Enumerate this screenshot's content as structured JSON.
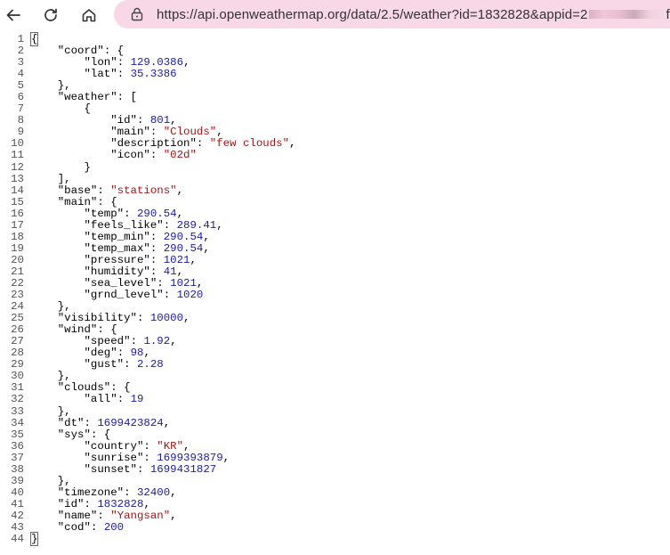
{
  "browser": {
    "url_text": "https://api.openweathermap.org/data/2.5/weather?id=1832828&appid=2",
    "url_tail": "f."
  },
  "json_lines": [
    [
      [
        "p",
        "{"
      ]
    ],
    [
      [
        "p",
        "    "
      ],
      [
        "k",
        "\"coord\""
      ],
      [
        "p",
        ": {"
      ]
    ],
    [
      [
        "p",
        "        "
      ],
      [
        "k",
        "\"lon\""
      ],
      [
        "p",
        ": "
      ],
      [
        "n",
        "129.0386"
      ],
      [
        "p",
        ","
      ]
    ],
    [
      [
        "p",
        "        "
      ],
      [
        "k",
        "\"lat\""
      ],
      [
        "p",
        ": "
      ],
      [
        "n",
        "35.3386"
      ]
    ],
    [
      [
        "p",
        "    },"
      ]
    ],
    [
      [
        "p",
        "    "
      ],
      [
        "k",
        "\"weather\""
      ],
      [
        "p",
        ": ["
      ]
    ],
    [
      [
        "p",
        "        {"
      ]
    ],
    [
      [
        "p",
        "            "
      ],
      [
        "k",
        "\"id\""
      ],
      [
        "p",
        ": "
      ],
      [
        "n",
        "801"
      ],
      [
        "p",
        ","
      ]
    ],
    [
      [
        "p",
        "            "
      ],
      [
        "k",
        "\"main\""
      ],
      [
        "p",
        ": "
      ],
      [
        "s",
        "\"Clouds\""
      ],
      [
        "p",
        ","
      ]
    ],
    [
      [
        "p",
        "            "
      ],
      [
        "k",
        "\"description\""
      ],
      [
        "p",
        ": "
      ],
      [
        "s",
        "\"few clouds\""
      ],
      [
        "p",
        ","
      ]
    ],
    [
      [
        "p",
        "            "
      ],
      [
        "k",
        "\"icon\""
      ],
      [
        "p",
        ": "
      ],
      [
        "s",
        "\"02d\""
      ]
    ],
    [
      [
        "p",
        "        }"
      ]
    ],
    [
      [
        "p",
        "    ],"
      ]
    ],
    [
      [
        "p",
        "    "
      ],
      [
        "k",
        "\"base\""
      ],
      [
        "p",
        ": "
      ],
      [
        "s",
        "\"stations\""
      ],
      [
        "p",
        ","
      ]
    ],
    [
      [
        "p",
        "    "
      ],
      [
        "k",
        "\"main\""
      ],
      [
        "p",
        ": {"
      ]
    ],
    [
      [
        "p",
        "        "
      ],
      [
        "k",
        "\"temp\""
      ],
      [
        "p",
        ": "
      ],
      [
        "n",
        "290.54"
      ],
      [
        "p",
        ","
      ]
    ],
    [
      [
        "p",
        "        "
      ],
      [
        "k",
        "\"feels_like\""
      ],
      [
        "p",
        ": "
      ],
      [
        "n",
        "289.41"
      ],
      [
        "p",
        ","
      ]
    ],
    [
      [
        "p",
        "        "
      ],
      [
        "k",
        "\"temp_min\""
      ],
      [
        "p",
        ": "
      ],
      [
        "n",
        "290.54"
      ],
      [
        "p",
        ","
      ]
    ],
    [
      [
        "p",
        "        "
      ],
      [
        "k",
        "\"temp_max\""
      ],
      [
        "p",
        ": "
      ],
      [
        "n",
        "290.54"
      ],
      [
        "p",
        ","
      ]
    ],
    [
      [
        "p",
        "        "
      ],
      [
        "k",
        "\"pressure\""
      ],
      [
        "p",
        ": "
      ],
      [
        "n",
        "1021"
      ],
      [
        "p",
        ","
      ]
    ],
    [
      [
        "p",
        "        "
      ],
      [
        "k",
        "\"humidity\""
      ],
      [
        "p",
        ": "
      ],
      [
        "n",
        "41"
      ],
      [
        "p",
        ","
      ]
    ],
    [
      [
        "p",
        "        "
      ],
      [
        "k",
        "\"sea_level\""
      ],
      [
        "p",
        ": "
      ],
      [
        "n",
        "1021"
      ],
      [
        "p",
        ","
      ]
    ],
    [
      [
        "p",
        "        "
      ],
      [
        "k",
        "\"grnd_level\""
      ],
      [
        "p",
        ": "
      ],
      [
        "n",
        "1020"
      ]
    ],
    [
      [
        "p",
        "    },"
      ]
    ],
    [
      [
        "p",
        "    "
      ],
      [
        "k",
        "\"visibility\""
      ],
      [
        "p",
        ": "
      ],
      [
        "n",
        "10000"
      ],
      [
        "p",
        ","
      ]
    ],
    [
      [
        "p",
        "    "
      ],
      [
        "k",
        "\"wind\""
      ],
      [
        "p",
        ": {"
      ]
    ],
    [
      [
        "p",
        "        "
      ],
      [
        "k",
        "\"speed\""
      ],
      [
        "p",
        ": "
      ],
      [
        "n",
        "1.92"
      ],
      [
        "p",
        ","
      ]
    ],
    [
      [
        "p",
        "        "
      ],
      [
        "k",
        "\"deg\""
      ],
      [
        "p",
        ": "
      ],
      [
        "n",
        "98"
      ],
      [
        "p",
        ","
      ]
    ],
    [
      [
        "p",
        "        "
      ],
      [
        "k",
        "\"gust\""
      ],
      [
        "p",
        ": "
      ],
      [
        "n",
        "2.28"
      ]
    ],
    [
      [
        "p",
        "    },"
      ]
    ],
    [
      [
        "p",
        "    "
      ],
      [
        "k",
        "\"clouds\""
      ],
      [
        "p",
        ": {"
      ]
    ],
    [
      [
        "p",
        "        "
      ],
      [
        "k",
        "\"all\""
      ],
      [
        "p",
        ": "
      ],
      [
        "n",
        "19"
      ]
    ],
    [
      [
        "p",
        "    },"
      ]
    ],
    [
      [
        "p",
        "    "
      ],
      [
        "k",
        "\"dt\""
      ],
      [
        "p",
        ": "
      ],
      [
        "n",
        "1699423824"
      ],
      [
        "p",
        ","
      ]
    ],
    [
      [
        "p",
        "    "
      ],
      [
        "k",
        "\"sys\""
      ],
      [
        "p",
        ": {"
      ]
    ],
    [
      [
        "p",
        "        "
      ],
      [
        "k",
        "\"country\""
      ],
      [
        "p",
        ": "
      ],
      [
        "s",
        "\"KR\""
      ],
      [
        "p",
        ","
      ]
    ],
    [
      [
        "p",
        "        "
      ],
      [
        "k",
        "\"sunrise\""
      ],
      [
        "p",
        ": "
      ],
      [
        "n",
        "1699393879"
      ],
      [
        "p",
        ","
      ]
    ],
    [
      [
        "p",
        "        "
      ],
      [
        "k",
        "\"sunset\""
      ],
      [
        "p",
        ": "
      ],
      [
        "n",
        "1699431827"
      ]
    ],
    [
      [
        "p",
        "    },"
      ]
    ],
    [
      [
        "p",
        "    "
      ],
      [
        "k",
        "\"timezone\""
      ],
      [
        "p",
        ": "
      ],
      [
        "n",
        "32400"
      ],
      [
        "p",
        ","
      ]
    ],
    [
      [
        "p",
        "    "
      ],
      [
        "k",
        "\"id\""
      ],
      [
        "p",
        ": "
      ],
      [
        "n",
        "1832828"
      ],
      [
        "p",
        ","
      ]
    ],
    [
      [
        "p",
        "    "
      ],
      [
        "k",
        "\"name\""
      ],
      [
        "p",
        ": "
      ],
      [
        "s",
        "\"Yangsan\""
      ],
      [
        "p",
        ","
      ]
    ],
    [
      [
        "p",
        "    "
      ],
      [
        "k",
        "\"cod\""
      ],
      [
        "p",
        ": "
      ],
      [
        "n",
        "200"
      ]
    ],
    [
      [
        "p",
        "}"
      ]
    ]
  ]
}
